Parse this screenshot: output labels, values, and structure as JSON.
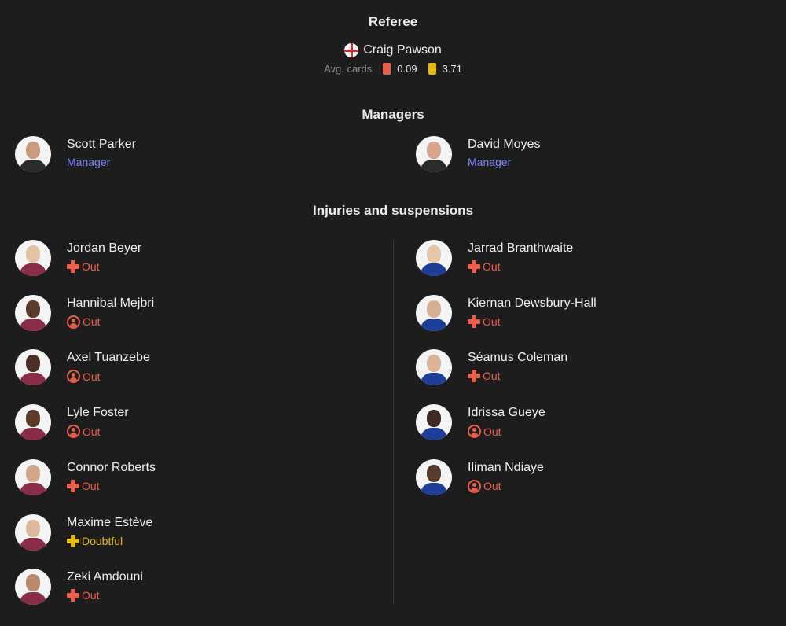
{
  "referee": {
    "title": "Referee",
    "name": "Craig Pawson",
    "avg_cards_label": "Avg. cards",
    "red_avg": "0.09",
    "yellow_avg": "3.71"
  },
  "managers": {
    "title": "Managers",
    "home": {
      "name": "Scott Parker",
      "role": "Manager"
    },
    "away": {
      "name": "David Moyes",
      "role": "Manager"
    }
  },
  "injuries": {
    "title": "Injuries and suspensions",
    "home": [
      {
        "name": "Jordan Beyer",
        "status": "Out",
        "icon": "injury-cross-icon"
      },
      {
        "name": "Hannibal Mejbri",
        "status": "Out",
        "icon": "suspension-person-icon"
      },
      {
        "name": "Axel Tuanzebe",
        "status": "Out",
        "icon": "suspension-person-icon"
      },
      {
        "name": "Lyle Foster",
        "status": "Out",
        "icon": "suspension-person-icon"
      },
      {
        "name": "Connor Roberts",
        "status": "Out",
        "icon": "injury-cross-icon"
      },
      {
        "name": "Maxime Estève",
        "status": "Doubtful",
        "icon": "injury-cross-icon"
      },
      {
        "name": "Zeki Amdouni",
        "status": "Out",
        "icon": "injury-cross-icon"
      }
    ],
    "away": [
      {
        "name": "Jarrad Branthwaite",
        "status": "Out",
        "icon": "injury-cross-icon"
      },
      {
        "name": "Kiernan Dewsbury-Hall",
        "status": "Out",
        "icon": "injury-cross-icon"
      },
      {
        "name": "Séamus Coleman",
        "status": "Out",
        "icon": "injury-cross-icon"
      },
      {
        "name": "Idrissa Gueye",
        "status": "Out",
        "icon": "suspension-person-icon"
      },
      {
        "name": "Iliman Ndiaye",
        "status": "Out",
        "icon": "suspension-person-icon"
      }
    ]
  },
  "colors": {
    "out": "#e8604c",
    "doubtful": "#e6b90c",
    "manager_role": "#7f86ff",
    "burnley_shirt": "#8a2c47",
    "everton_shirt": "#1d3f9a"
  }
}
